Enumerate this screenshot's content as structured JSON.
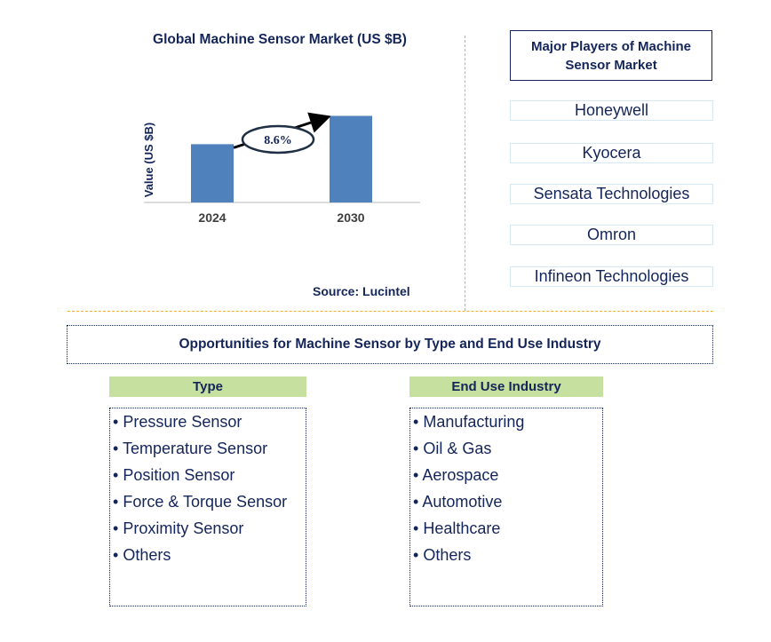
{
  "chart_data": {
    "type": "bar",
    "title": "Global Machine Sensor Market (US $B)",
    "xlabel": "",
    "ylabel": "Value (US $B)",
    "categories": [
      "2024",
      "2030"
    ],
    "values": [
      3.5,
      5.2
    ],
    "ylim": [
      0,
      8
    ],
    "grid": false,
    "bar_color": "#4f81bd",
    "annotation": {
      "label": "8.6%",
      "meaning": "CAGR 2024-2030"
    },
    "source": "Source: Lucintel"
  },
  "players": {
    "header": "Major Players of Machine Sensor Market",
    "items": [
      "Honeywell",
      "Kyocera",
      "Sensata Technologies",
      "Omron",
      "Infineon Technologies"
    ]
  },
  "opportunities": {
    "title": "Opportunities for Machine Sensor by Type and End Use Industry",
    "type": {
      "header": "Type",
      "items": [
        "Pressure Sensor",
        "Temperature Sensor",
        "Position Sensor",
        "Force & Torque Sensor",
        "Proximity Sensor",
        "Others"
      ]
    },
    "end_use": {
      "header": "End Use Industry",
      "items": [
        "Manufacturing",
        "Oil & Gas",
        "Aerospace",
        "Automotive",
        "Healthcare",
        "Others"
      ]
    }
  },
  "bullet": "•"
}
